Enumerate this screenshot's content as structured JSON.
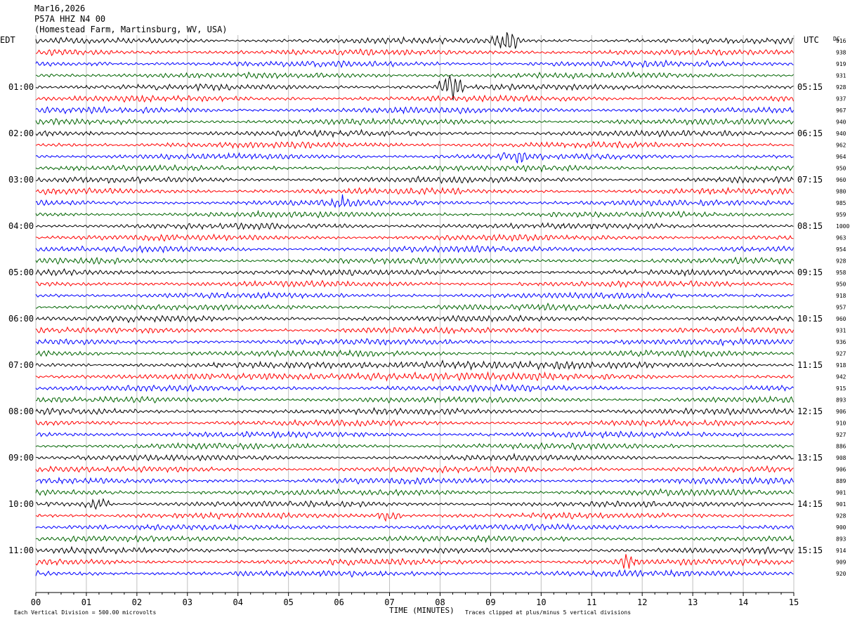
{
  "header": {
    "date": "Mar16,2026",
    "station": "P57A HHZ N4 00",
    "location": "(Homestead Farm, Martinsburg, WV, USA)"
  },
  "left_label": "EDT",
  "right_label": "UTC",
  "dc_label": "DC",
  "footer": {
    "note_left": "Each Vertical Division =  500.00 microvolts",
    "xlabel": "TIME (MINUTES)",
    "note_right": "Traces clipped at plus/minus 5 vertical divisions"
  },
  "colors": {
    "black": "#000000",
    "red": "#ff0000",
    "blue": "#0000ff",
    "green": "#006400",
    "grid": "#c0c0c0"
  },
  "chart_data": {
    "type": "line",
    "subtype": "helicorder",
    "title": "P57A HHZ N4 00",
    "xlabel": "TIME (MINUTES)",
    "xlim": [
      0,
      15
    ],
    "xticks": [
      "00",
      "01",
      "02",
      "03",
      "04",
      "05",
      "06",
      "07",
      "08",
      "09",
      "10",
      "11",
      "12",
      "13",
      "14",
      "15"
    ],
    "trace_minutes": 15,
    "color_cycle": [
      "black",
      "red",
      "blue",
      "green"
    ],
    "left_time_labels": [
      "01:00",
      "02:00",
      "03:00",
      "04:00",
      "05:00",
      "06:00",
      "07:00",
      "08:00",
      "09:00",
      "10:00",
      "11:00"
    ],
    "right_time_labels": [
      "05:15",
      "06:15",
      "07:15",
      "08:15",
      "09:15",
      "10:15",
      "11:15",
      "12:15",
      "13:15",
      "14:15",
      "15:15"
    ],
    "dc_offsets": [
      916,
      938,
      919,
      931,
      928,
      937,
      967,
      940,
      940,
      962,
      964,
      950,
      960,
      980,
      985,
      959,
      1000,
      963,
      954,
      928,
      958,
      950,
      918,
      957,
      960,
      931,
      936,
      927,
      918,
      942,
      915,
      893,
      906,
      910,
      927,
      886,
      908,
      906,
      889,
      901,
      901,
      928,
      900,
      893,
      914,
      909,
      920
    ],
    "events": [
      {
        "trace": 0,
        "minute": 9.3,
        "amplitude": "large"
      },
      {
        "trace": 4,
        "minute": 8.2,
        "amplitude": "large"
      },
      {
        "trace": 10,
        "minute": 9.4,
        "amplitude": "medium"
      },
      {
        "trace": 14,
        "minute": 6.1,
        "amplitude": "medium"
      },
      {
        "trace": 28,
        "minute": 8.5,
        "amplitude": "elevated noise"
      },
      {
        "trace": 29,
        "minute": 7.5,
        "amplitude": "elevated noise"
      },
      {
        "trace": 40,
        "minute": 1.2,
        "amplitude": "medium"
      },
      {
        "trace": 41,
        "minute": 7.0,
        "amplitude": "medium"
      },
      {
        "trace": 45,
        "minute": 11.7,
        "amplitude": "medium"
      }
    ]
  }
}
